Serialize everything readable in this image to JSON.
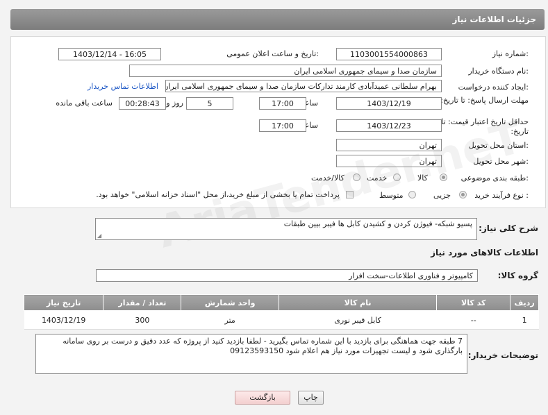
{
  "header": {
    "title": "جزئیات اطلاعات نیاز"
  },
  "form": {
    "need_number_label": "شماره نیاز:",
    "need_number": "1103001554000863",
    "announce_label": "تاریخ و ساعت اعلان عمومی:",
    "announce_value": "1403/12/14 - 16:05",
    "buyer_org_label": "نام دستگاه خریدار:",
    "buyer_org": "سازمان صدا و سیمای جمهوری اسلامی ایران",
    "requester_label": "ایجاد کننده درخواست:",
    "requester": "بهرام سلطانی عمیدآبادی کارمند تدارکات سازمان صدا و سیمای جمهوری اسلامی ایران",
    "buyer_contact_link": "اطلاعات تماس خریدار",
    "deadline_label": "مهلت ارسال پاسخ: تا تاریخ:",
    "deadline_date": "1403/12/19",
    "time_label": "ساعت",
    "deadline_time": "17:00",
    "days_value": "5",
    "days_label": "روز و",
    "remaining_value": "00:28:43",
    "remaining_label": "ساعت باقی مانده",
    "validity_label": "حداقل تاریخ اعتبار قیمت: تا تاریخ:",
    "validity_date": "1403/12/23",
    "validity_time": "17:00",
    "province_label": "استان محل تحویل:",
    "province": "تهران",
    "city_label": "شهر محل تحویل:",
    "city": "تهران",
    "category_label": "طبقه بندی موضوعی:",
    "category_options": [
      "کالا",
      "خدمت",
      "کالا/خدمت"
    ],
    "process_label": "نوع فرآیند خرید :",
    "process_options": [
      "جزیی",
      "متوسط"
    ],
    "payment_note": "پرداخت تمام یا بخشی از مبلغ خرید،از محل \"اسناد خزانه اسلامی\" خواهد بود."
  },
  "summary": {
    "label": "شرح کلی نیاز:",
    "value": "پسیو شبکه- فیوژن کردن و کشیدن کابل ها فیبر بیین طبقات"
  },
  "goods_section_title": "اطلاعات کالاهای مورد نیاز",
  "goods_group": {
    "label": "گروه کالا:",
    "value": "کامپیوتر و فناوری اطلاعات-سخت افزار"
  },
  "table": {
    "headers": [
      "ردیف",
      "کد کالا",
      "نام کالا",
      "واحد شمارش",
      "تعداد / مقدار",
      "تاریخ نیاز"
    ],
    "rows": [
      [
        "1",
        "--",
        "کابل فیبر نوری",
        "متر",
        "300",
        "1403/12/19"
      ]
    ]
  },
  "buyer_notes": {
    "label": "توضیحات خریدار:",
    "value": "7 طبقه    جهت هماهنگی برای بازدید  با این شماره تماس بگیرید  -    لطفا بازدید کنید از پروژه که عدد دقیق و درست بر روی سامانه بارگذاری شود و لیست تجهیزات مورد نیاز هم اعلام شود 09123593150"
  },
  "buttons": {
    "print": "چاپ",
    "back": "بازگشت"
  },
  "watermark": "AriaTender.neT"
}
